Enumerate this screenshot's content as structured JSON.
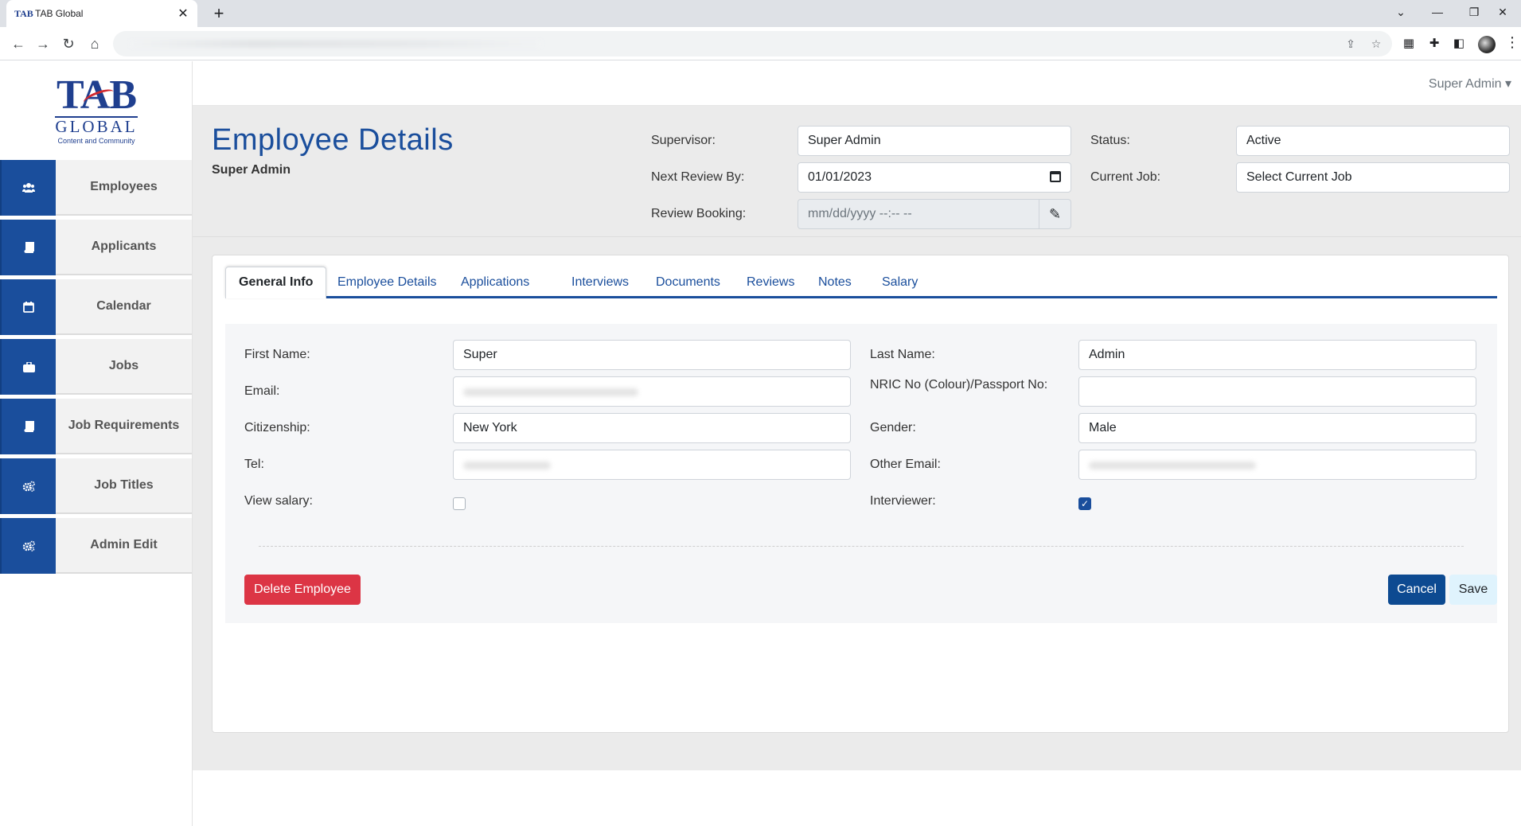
{
  "browser": {
    "tab_title": "TAB Global",
    "favicon_text": "TAB",
    "close": "✕",
    "new_tab": "+"
  },
  "logo": {
    "tab": "TAB",
    "global": "GLOBAL",
    "tagline": "Content and Community"
  },
  "sidebar": {
    "items": [
      {
        "label": "Employees",
        "icon": "users-icon"
      },
      {
        "label": "Applicants",
        "icon": "book-icon"
      },
      {
        "label": "Calendar",
        "icon": "calendar-icon"
      },
      {
        "label": "Jobs",
        "icon": "briefcase-icon"
      },
      {
        "label": "Job Requirements",
        "icon": "book-icon"
      },
      {
        "label": "Job Titles",
        "icon": "cogs-icon"
      },
      {
        "label": "Admin Edit",
        "icon": "cogs-icon"
      }
    ]
  },
  "topbar": {
    "user": "Super Admin ▾"
  },
  "header": {
    "title": "Employee Details",
    "subtitle": "Super Admin",
    "supervisor_label": "Supervisor:",
    "supervisor_value": "Super Admin",
    "next_review_label": "Next Review By:",
    "next_review_value": "01/01/2023",
    "review_booking_label": "Review Booking:",
    "review_booking_value": "mm/dd/yyyy --:-- --",
    "status_label": "Status:",
    "status_value": "Active",
    "current_job_label": "Current Job:",
    "current_job_value": "Select Current Job"
  },
  "tabs": [
    {
      "label": "General Info",
      "active": true
    },
    {
      "label": "Employee Details"
    },
    {
      "label": "Applications"
    },
    {
      "label": "Interviews"
    },
    {
      "label": "Documents"
    },
    {
      "label": "Reviews"
    },
    {
      "label": "Notes"
    },
    {
      "label": "Salary"
    }
  ],
  "form": {
    "first_name_label": "First Name:",
    "first_name_value": "Super",
    "last_name_label": "Last Name:",
    "last_name_value": "Admin",
    "email_label": "Email:",
    "nric_label": "NRIC No (Colour)/Passport No:",
    "nric_value": "",
    "citizenship_label": "Citizenship:",
    "citizenship_value": "New York",
    "gender_label": "Gender:",
    "gender_value": "Male",
    "tel_label": "Tel:",
    "other_email_label": "Other Email:",
    "view_salary_label": "View salary:",
    "view_salary_checked": false,
    "interviewer_label": "Interviewer:",
    "interviewer_checked": true
  },
  "buttons": {
    "delete": "Delete Employee",
    "cancel": "Cancel",
    "save": "Save"
  },
  "colors": {
    "primary": "#1a4e9c",
    "danger": "#dc3545",
    "header_bg": "#ebebeb"
  }
}
